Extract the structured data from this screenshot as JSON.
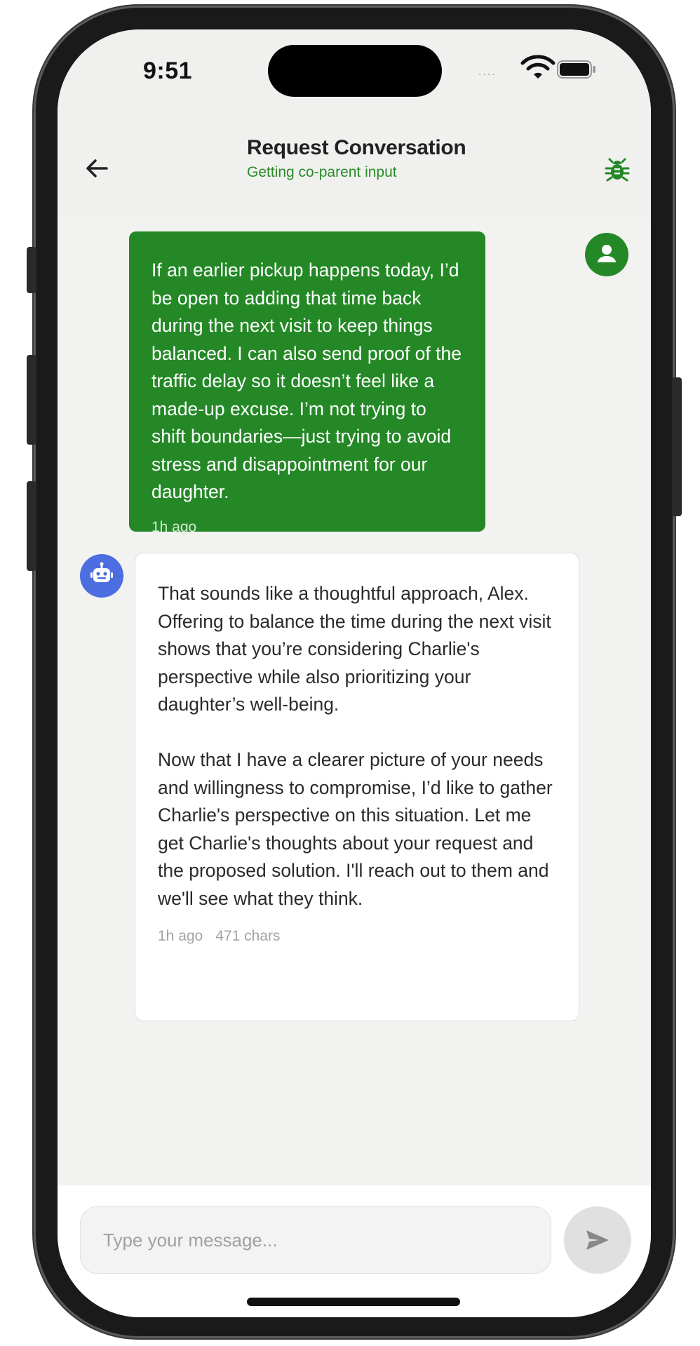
{
  "status_bar": {
    "time": "9:51",
    "signal_dots": "....",
    "wifi_icon": "wifi-icon",
    "battery_icon": "battery-icon"
  },
  "header": {
    "title": "Request Conversation",
    "subtitle": "Getting co-parent input",
    "back_icon": "arrow-left-icon",
    "debug_icon": "bug-icon"
  },
  "messages": [
    {
      "role": "user",
      "text": "If an earlier pickup happens today, I’d be open to adding that time back during the next visit to keep things balanced. I can also send proof of the traffic delay so it doesn’t feel like a made-up excuse. I’m not trying to shift boundaries—just trying to avoid stress and disappointment for our daughter.",
      "time": "1h ago",
      "avatar_icon": "person-icon"
    },
    {
      "role": "assistant",
      "paragraphs": [
        "That sounds like a thoughtful approach, Alex. Offering to balance the time during the next visit shows that you’re considering Charlie's perspective while also prioritizing your daughter’s well-being.",
        "Now that I have a clearer picture of your needs and willingness to compromise, I’d like to gather Charlie's perspective on this situation. Let me get Charlie's thoughts about your request and the proposed solution. I'll reach out to them and we'll see what they think."
      ],
      "time": "1h ago",
      "chars": "471 chars",
      "avatar_icon": "robot-icon"
    }
  ],
  "composer": {
    "placeholder": "Type your message...",
    "value": "",
    "send_icon": "send-icon"
  },
  "colors": {
    "accent_green": "#248826",
    "bot_blue": "#4d6ee0",
    "subtitle_green": "#2a8a2a"
  }
}
